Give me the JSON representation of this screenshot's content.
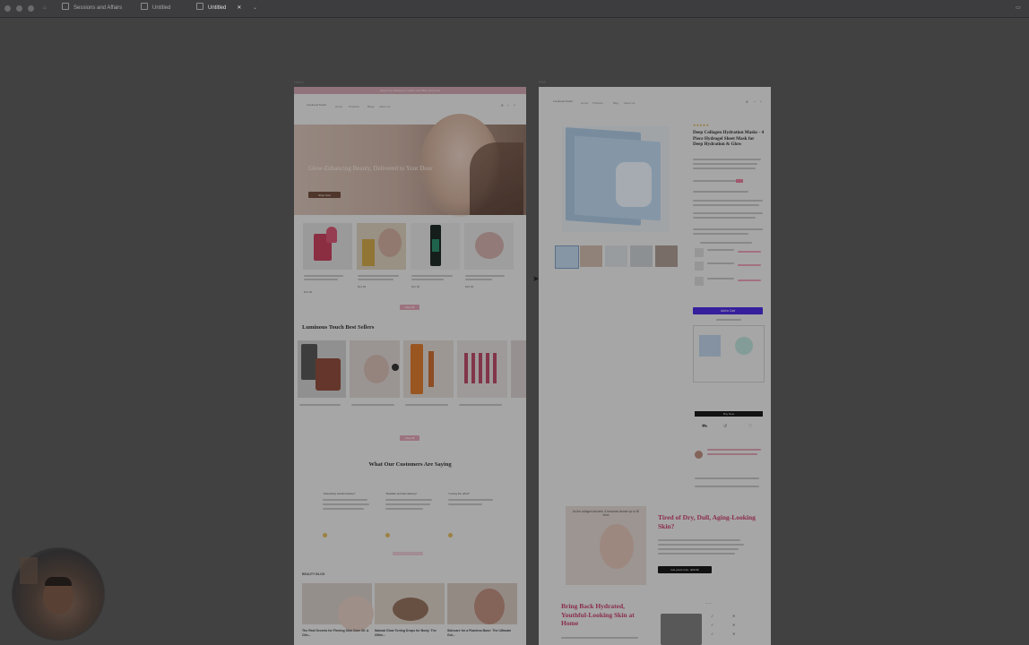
{
  "window": {
    "tabs": [
      {
        "label": "Sessions and Affairs"
      },
      {
        "label": "Untitled"
      },
      {
        "label": "Untitled"
      }
    ]
  },
  "canvas": {
    "left_label": "Home",
    "right_label": "PDP"
  },
  "home": {
    "announcement": "Enjoy free shipping on orders over $50 | shop now",
    "logo": "Luminous Touch",
    "nav": [
      "Home",
      "Products",
      "Blogs",
      "About Us"
    ],
    "hero_title": "Glow-Enhancing Beauty, Delivered to Your Door",
    "hero_button": "Shop Now",
    "featured_prices": [
      "$15.99",
      "$24.99",
      "$12.99",
      "$19.99"
    ],
    "view_all_1": "View All",
    "best_sellers_title": "Luminous Touch Best Sellers",
    "view_all_2": "View All",
    "testimonials_title": "What Our Customers Are Saying",
    "testimonial_quotes": [
      "\"Absolutely transformative!\"",
      "\"Reliable and fast delivery\"",
      "\"Loving the effect\""
    ],
    "blog_label": "BEAUTY BLOG",
    "blog_posts": [
      "The Real Secrets for Firming Skin Over 30: A Clin...",
      "Natural Glow Toning Drops for Body: The Ultim...",
      "Skincare for a Flawless Base: The Ultimate Gui..."
    ]
  },
  "pdp": {
    "logo": "Luminous Touch",
    "nav": [
      "Home",
      "Products",
      "Blog",
      "About Us"
    ],
    "product_title": "Deep Collagen Hydration Masks - 4 Piece Hydrogel Sheet Mask for Deep Hydration & Glow",
    "add_to_cart": "Add to Cart",
    "buy_now": "Buy Now",
    "section1_title": "Tired of Dry, Dull, Aging-Looking Skin?",
    "section1_caption": "As the collagen absorbs, it becomes clearer up to 30 mins",
    "section1_button": "Get yours now - $29.99",
    "section2_title": "Bring Back Hydrated, Youthful-Looking Skin at Home"
  },
  "colors": {
    "background": "#5a5a5c",
    "accent_pink": "#c0406a",
    "cta_purple": "#4a2bd8"
  }
}
